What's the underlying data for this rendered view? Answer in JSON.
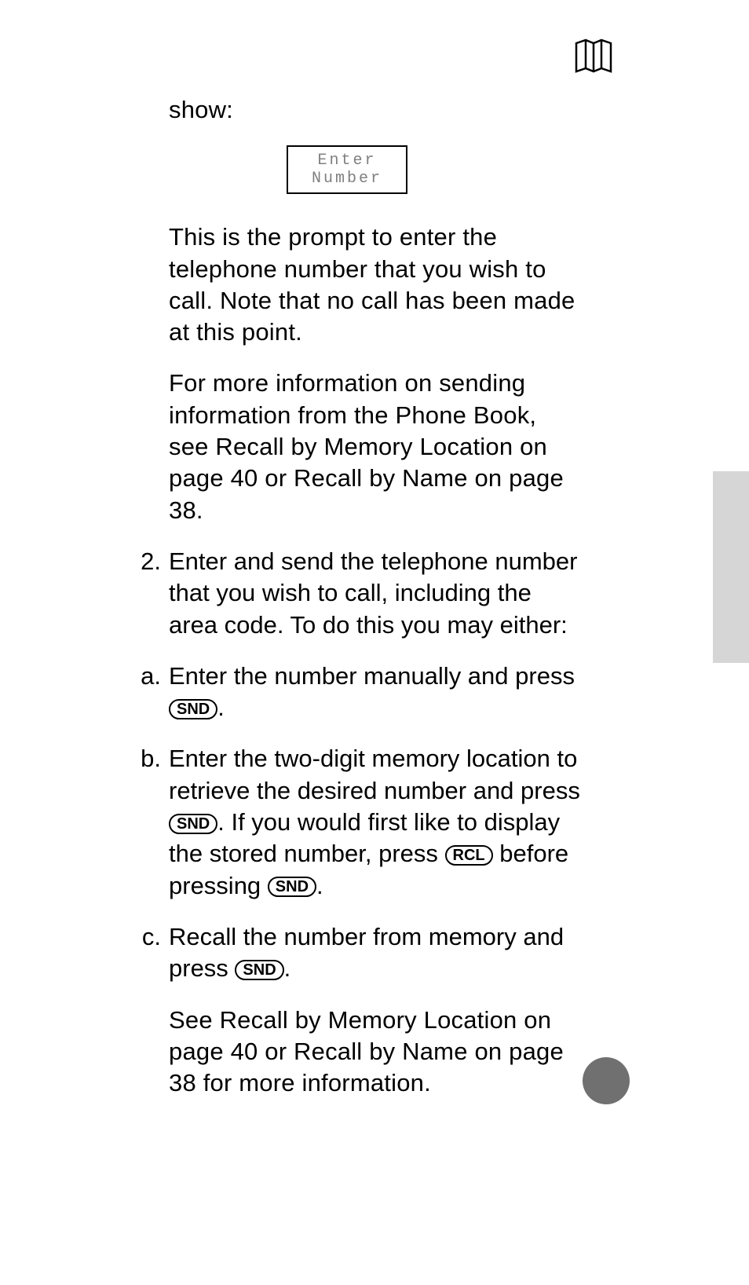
{
  "intro": "show:",
  "lcd_line1": "Enter",
  "lcd_line2": "Number",
  "para1": "This is the prompt to enter the telephone number that you wish to call. Note that no call has been made at this point.",
  "para2": "For more information on sending information from the Phone Book, see Recall by Memory Location on page 40 or Recall by Name on page 38.",
  "step2_marker": "2.",
  "step2_body": "Enter and send the telephone number that you wish to call, including the area code. To do this you may either:",
  "a_marker": "a.",
  "a_pre": "Enter the number manually and press ",
  "a_btn": "SND",
  "a_post": ".",
  "b_marker": "b.",
  "b_pre": "Enter the two-digit memory location to retrieve the desired number and press ",
  "b_btn1": "SND",
  "b_mid": ". If you would first like to display the stored number, press ",
  "b_btn2": "RCL",
  "b_mid2": " before pressing ",
  "b_btn3": "SND",
  "b_post": ".",
  "c_marker": "c.",
  "c_pre": "Recall the number from memory and press ",
  "c_btn": "SND",
  "c_post": ".",
  "para3": "See Recall by Memory Location on page 40 or Recall by Name on page 38 for more information."
}
